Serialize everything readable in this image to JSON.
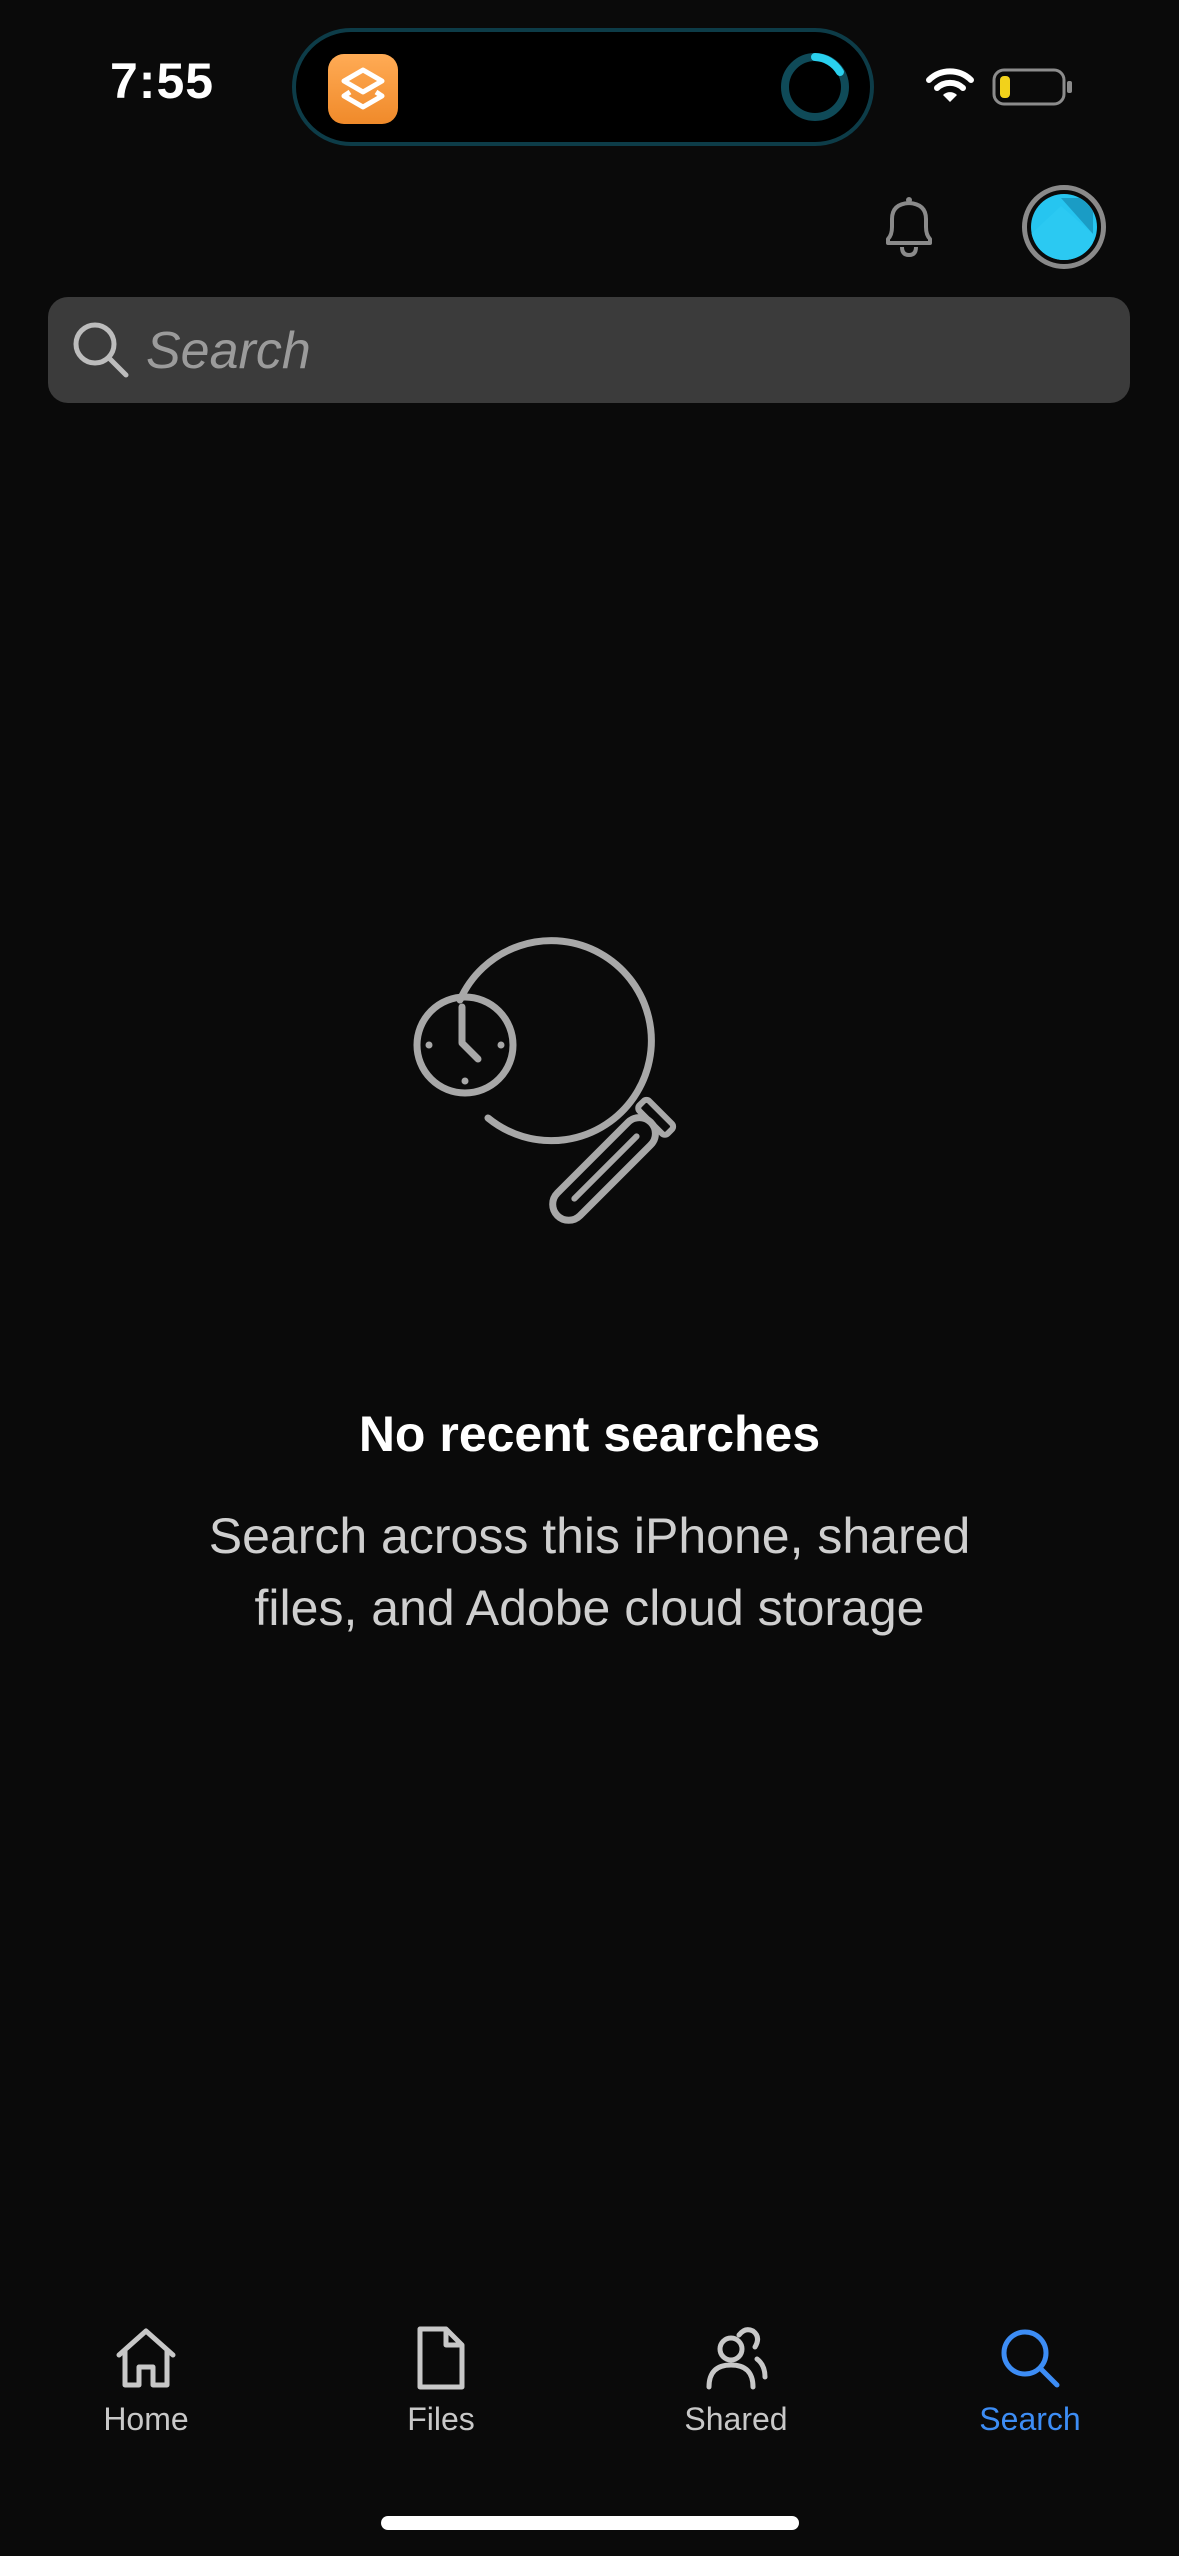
{
  "status_bar": {
    "time": "7:55",
    "icons": [
      "wifi-icon",
      "battery-icon"
    ],
    "battery_color": "#f2d21b"
  },
  "dynamic_island": {
    "app_icon": "shortcuts-app-icon",
    "activity_icon": "progress-ring-icon",
    "accent": "#1ea0b8"
  },
  "header": {
    "notification_icon": "bell-icon",
    "avatar_icon": "avatar",
    "avatar_color": "#26c5f0"
  },
  "search": {
    "placeholder": "Search",
    "value": ""
  },
  "empty_state": {
    "illustration": "recent-search-icon",
    "title": "No recent searches",
    "description": "Search across this iPhone, shared files, and Adobe cloud storage"
  },
  "tabbar": {
    "active_color": "#3d8df5",
    "tabs": [
      {
        "label": "Home",
        "icon": "home-icon"
      },
      {
        "label": "Files",
        "icon": "file-icon"
      },
      {
        "label": "Shared",
        "icon": "people-icon"
      },
      {
        "label": "Search",
        "icon": "search-icon"
      }
    ]
  }
}
